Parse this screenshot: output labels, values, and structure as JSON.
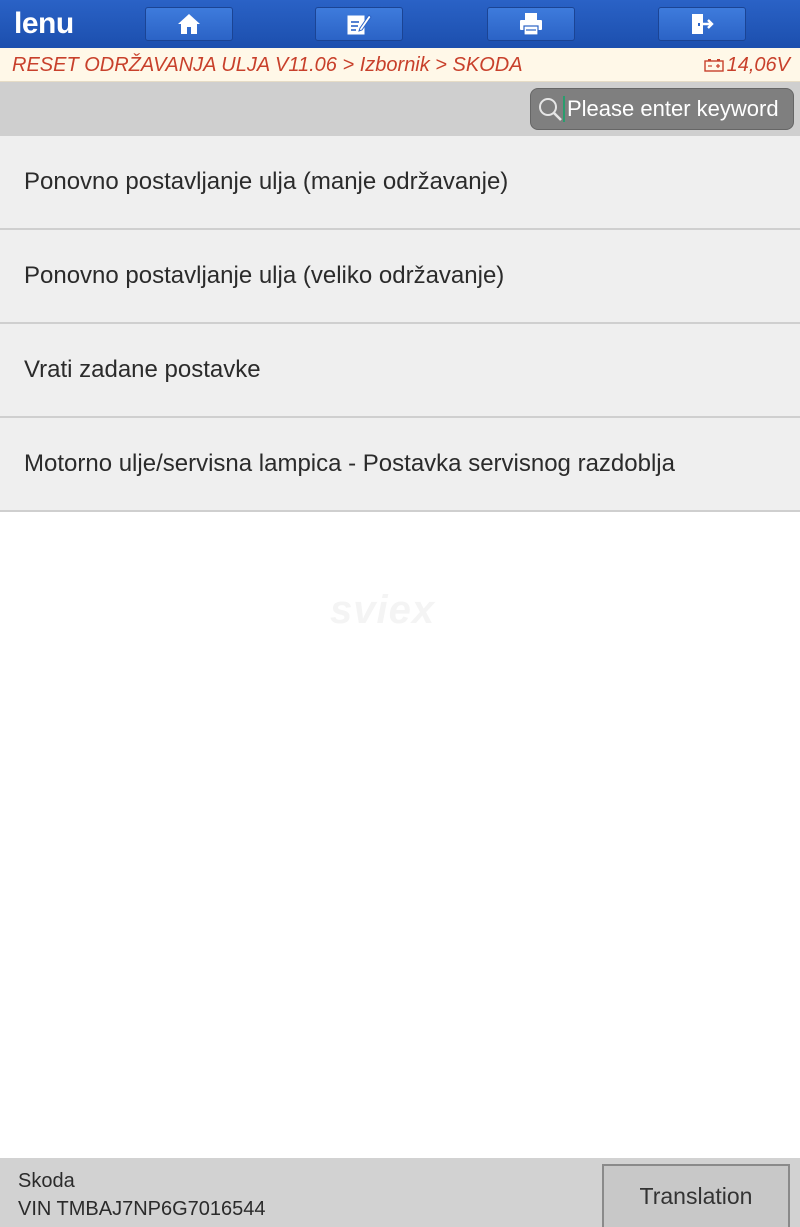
{
  "header": {
    "title": "lenu",
    "buttons": [
      {
        "icon": "home-icon"
      },
      {
        "icon": "edit-icon"
      },
      {
        "icon": "print-icon"
      },
      {
        "icon": "exit-icon"
      }
    ]
  },
  "breadcrumb": {
    "path": "RESET ODRŽAVANJA ULJA V11.06 > Izbornik > SKODA",
    "voltage": "14,06V",
    "voltage_icon": "battery-icon"
  },
  "search": {
    "placeholder": "Please enter keyword",
    "value": ""
  },
  "menu": {
    "items": [
      {
        "label": "Ponovno postavljanje ulja (manje održavanje)"
      },
      {
        "label": "Ponovno postavljanje ulja (veliko održavanje)"
      },
      {
        "label": "Vrati zadane postavke"
      },
      {
        "label": "Motorno ulje/servisna lampica - Postavka servisnog razdoblja"
      }
    ]
  },
  "watermark": "sviex",
  "footer": {
    "vehicle": "Skoda",
    "vin": "VIN TMBAJ7NP6G7016544",
    "translation_label": "Translation"
  },
  "colors": {
    "header_blue": "#1c4fae",
    "breadcrumb_text": "#c8402b",
    "search_band": "#cfcfcf",
    "menu_item_bg": "#efefef",
    "footer_bg": "#d2d2d2"
  }
}
